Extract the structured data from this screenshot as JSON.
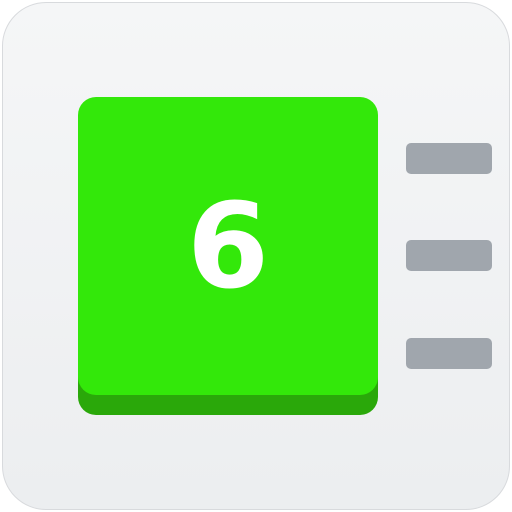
{
  "tile": {
    "number": "6",
    "color": "#33e80a",
    "shadow_color": "#2aa80a",
    "text_color": "#ffffff"
  },
  "lines": {
    "count": 3,
    "color": "#a0a6ad"
  },
  "frame": {
    "background": "#f1f2f4"
  }
}
